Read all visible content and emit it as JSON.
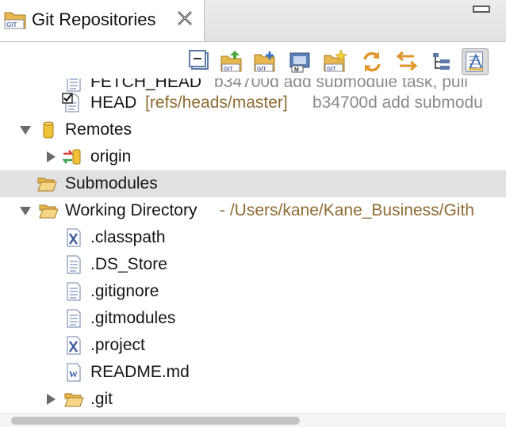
{
  "tab": {
    "title": "Git Repositories",
    "icon": "git-repository-icon",
    "close_icon": "close-x-icon"
  },
  "toolbar": {
    "buttons": [
      {
        "name": "collapse-all-icon"
      },
      {
        "name": "clone-git-repository-icon"
      },
      {
        "name": "add-existing-repository-icon"
      },
      {
        "name": "create-repository-icon"
      },
      {
        "name": "create-new-repository-icon"
      },
      {
        "name": "refresh-icon"
      },
      {
        "name": "link-with-selection-icon"
      },
      {
        "name": "hierarchical-layout-icon"
      },
      {
        "name": "view-menu-pressed-icon"
      }
    ]
  },
  "tree": {
    "fetch_head": {
      "name": "FETCH_HEAD",
      "detail": "b34700d add submodule task, pull"
    },
    "head": {
      "name": "HEAD",
      "ref": "[refs/heads/master]",
      "detail": "b34700d add submodu"
    },
    "remotes": {
      "label": "Remotes"
    },
    "origin": {
      "label": "origin"
    },
    "submodules": {
      "label": "Submodules"
    },
    "working_directory": {
      "label": "Working Directory",
      "path": "- /Users/kane/Kane_Business/Gith"
    },
    "files": [
      {
        "name": ".classpath",
        "type": "xml"
      },
      {
        "name": ".DS_Store",
        "type": "text"
      },
      {
        "name": ".gitignore",
        "type": "text"
      },
      {
        "name": ".gitmodules",
        "type": "text"
      },
      {
        "name": ".project",
        "type": "xml"
      },
      {
        "name": "README.md",
        "type": "word"
      }
    ],
    "git_folder": {
      "label": ".git"
    }
  },
  "colors": {
    "selection": "#e1e1e1",
    "decoration": "#8e6b33",
    "folder": "#e8b74f"
  }
}
